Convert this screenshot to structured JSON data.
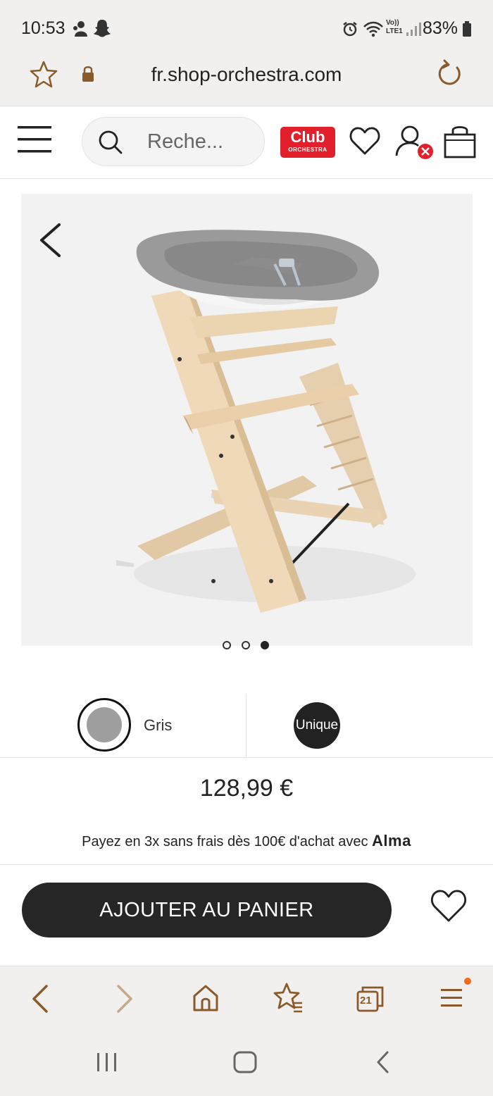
{
  "status_bar": {
    "time": "10:53",
    "lte": "LTE1",
    "volte": "Vo))",
    "battery": "83%"
  },
  "browser": {
    "url": "fr.shop-orchestra.com",
    "tab_count": "21"
  },
  "site_header": {
    "search_placeholder": "Reche...",
    "club_line1": "Club",
    "club_line2": "ORCHESTRA"
  },
  "product": {
    "gallery_dots": 3,
    "active_dot_index": 2,
    "color_label": "Gris",
    "size_label": "Unique",
    "price": "128,99 €",
    "installment_text": "Payez en 3x sans frais dès 100€ d'achat avec",
    "installment_brand": "Alma",
    "add_to_cart_label": "AJOUTER AU PANIER"
  },
  "colors": {
    "brand_red": "#e2202c",
    "browser_accent": "#8a5a2b",
    "button_dark": "#262626",
    "swatch_grey": "#9e9e9e",
    "menu_badge": "#f26b1d"
  }
}
